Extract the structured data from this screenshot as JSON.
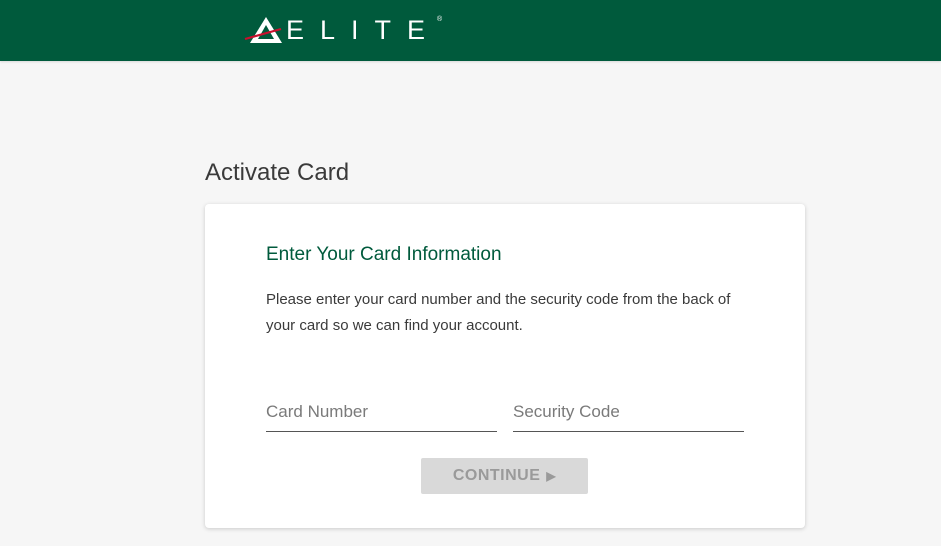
{
  "header": {
    "logo_text": "ELITE",
    "logo_registered": "®",
    "logo_icon": "delta-widget-icon",
    "background_color": "#005a3c"
  },
  "page": {
    "title": "Activate Card"
  },
  "card": {
    "heading": "Enter Your Card Information",
    "description": "Please enter your card number and the security code from the back of your card so we can find your account.",
    "card_number": {
      "value": "",
      "placeholder": "Card Number"
    },
    "security_code": {
      "value": "",
      "placeholder": "Security Code"
    },
    "continue_button": {
      "label": "CONTINUE",
      "arrow": "▶",
      "state": "disabled"
    }
  },
  "colors": {
    "brand_green": "#005a3c",
    "logo_red": "#c8102e",
    "button_disabled_bg": "#d9d9d9",
    "button_disabled_text": "#9a9a9a"
  }
}
